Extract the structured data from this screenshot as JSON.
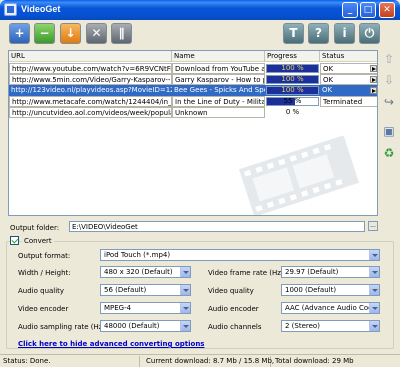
{
  "window": {
    "title": "VideoGet",
    "controls": [
      "minimize",
      "maximize",
      "close"
    ]
  },
  "toolbar": {
    "buttons": [
      {
        "name": "add-download-button",
        "icon": "plus-icon",
        "glyph": "+"
      },
      {
        "name": "remove-download-button",
        "icon": "minus-icon",
        "glyph": "−"
      },
      {
        "name": "start-download-button",
        "icon": "download-arrow-icon",
        "glyph": "↓"
      },
      {
        "name": "stop-download-button",
        "icon": "cross-icon",
        "glyph": "✕"
      },
      {
        "name": "pause-download-button",
        "icon": "pause-icon",
        "glyph": "∥"
      },
      {
        "name": "settings-button",
        "icon": "tools-icon",
        "glyph": "T"
      },
      {
        "name": "help-button",
        "icon": "question-icon",
        "glyph": "?"
      },
      {
        "name": "about-button",
        "icon": "info-icon",
        "glyph": "i"
      },
      {
        "name": "exit-button",
        "icon": "power-icon",
        "glyph": "⏻"
      }
    ]
  },
  "downloads": {
    "columns": [
      "URL",
      "Name",
      "Progress",
      "Status"
    ],
    "rows": [
      {
        "url": "http://www.youtube.com/watch?v=6R9VCNtFrs4",
        "name": "Download from YouTube and",
        "progress": 100,
        "progress_label": "100 %",
        "status": "OK",
        "selected": false
      },
      {
        "url": "http://www.5min.com/Video/Garry-Kasparov--Ho",
        "name": "Garry Kasparov - How to play",
        "progress": 100,
        "progress_label": "100 %",
        "status": "OK",
        "selected": false
      },
      {
        "url": "http://123video.nl/playvideos.asp?MovieID=124",
        "name": "Bee Gees - Spicks And Speck",
        "progress": 100,
        "progress_label": "100 %",
        "status": "OK",
        "selected": true
      },
      {
        "url": "http://www.metacafe.com/watch/1244404/in_th",
        "name": "In the Line of Duty - Military M",
        "progress": 55,
        "progress_label": "55 %",
        "status": "Terminated",
        "selected": false
      },
      {
        "url": "http://uncutvideo.aol.com/videos/week/popular/",
        "name": "Unknown",
        "progress": 0,
        "progress_label": "0 %",
        "status": "",
        "selected": false
      }
    ]
  },
  "side_tools": [
    {
      "name": "move-up-icon",
      "glyph": "⇧"
    },
    {
      "name": "move-down-icon",
      "glyph": "⇩"
    },
    {
      "name": "clear-list-icon",
      "glyph": "↪"
    },
    {
      "name": "properties-icon",
      "glyph": "▣"
    },
    {
      "name": "recycle-icon",
      "glyph": "♻"
    }
  ],
  "output": {
    "label": "Output folder:",
    "value": "E:\\VIDEO\\VideoGet",
    "browse_label": "..."
  },
  "convert": {
    "checkbox_label": "Convert",
    "checked": true,
    "output_format_label": "Output format:",
    "output_format_value": "iPod Touch (*.mp4)",
    "width_height_label": "Width / Height:",
    "width_height_value": "480 x 320 (Default)",
    "frame_rate_label": "Video frame rate (Hz):",
    "frame_rate_value": "29.97 (Default)",
    "audio_quality_label": "Audio quality",
    "audio_quality_value": "56 (Default)",
    "video_quality_label": "Video quality",
    "video_quality_value": "1000 (Default)",
    "video_encoder_label": "Video encoder",
    "video_encoder_value": "MPEG-4",
    "audio_encoder_label": "Audio encoder",
    "audio_encoder_value": "AAC (Advance Audio Codir",
    "sampling_rate_label": "Audio sampling rate (Hz):",
    "sampling_rate_value": "48000 (Default)",
    "audio_channels_label": "Audio channels",
    "audio_channels_value": "2 (Stereo)",
    "hide_link": "Click here to hide advanced converting options"
  },
  "status": {
    "state": "Status: Done.",
    "current": "Current download: 8.7 Mb / 15.8 Mb,",
    "total": "Total download: 29 Mb"
  },
  "colors": {
    "titlebar": "#0A5FE6",
    "selection": "#316AC5",
    "progress_fill": "#1D2F9A",
    "link": "#0000CC"
  }
}
